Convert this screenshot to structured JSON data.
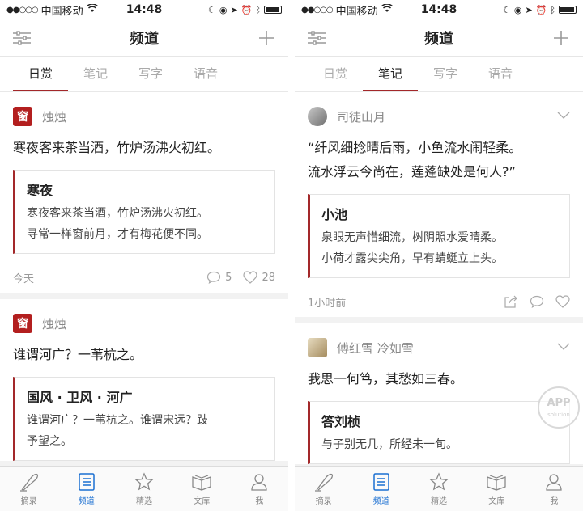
{
  "status": {
    "carrier": "中国移动",
    "time": "14:48"
  },
  "nav": {
    "title": "频道"
  },
  "tabs": [
    "日赏",
    "笔记",
    "写字",
    "语音"
  ],
  "left": {
    "cards": [
      {
        "author": "烛烛",
        "avatar_char": "窗",
        "excerpt": "寒夜客来茶当酒，竹炉汤沸火初红。",
        "quote_title": "寒夜",
        "quote_lines": [
          "寒夜客来茶当酒，竹炉汤沸火初红。",
          "寻常一样窗前月，才有梅花便不同。"
        ],
        "time": "今天",
        "comments": "5",
        "likes": "28"
      },
      {
        "author": "烛烛",
        "avatar_char": "窗",
        "excerpt": "谁谓河广？一苇杭之。",
        "quote_title": "国风 · 卫风 · 河广",
        "quote_lines": [
          "谁谓河广？一苇杭之。谁谓宋远？跂",
          "予望之。"
        ]
      }
    ]
  },
  "right": {
    "cards": [
      {
        "author": "司徒山月",
        "excerpt_lines": [
          "“纤风细捻晴后雨，小鱼流水闹轻柔。",
          "流水浮云今尚在，莲蓬缺处是何人?”"
        ],
        "quote_title": "小池",
        "quote_lines": [
          "泉眼无声惜细流，树阴照水爱晴柔。",
          "小荷才露尖尖角，早有蜻蜓立上头。"
        ],
        "time": "1小时前"
      },
      {
        "author": "傅红雪 冷如雪",
        "excerpt": "我思一何笃，其愁如三春。",
        "quote_title": "答刘桢",
        "quote_lines": [
          "与子别无几，所经未一旬。"
        ]
      }
    ]
  },
  "tabbar": [
    "摘录",
    "频道",
    "精选",
    "文库",
    "我"
  ],
  "watermark": {
    "main": "APP",
    "sub": "solution"
  },
  "colors": {
    "accent": "#a3282a",
    "tab_active": "#1b6fd1"
  }
}
